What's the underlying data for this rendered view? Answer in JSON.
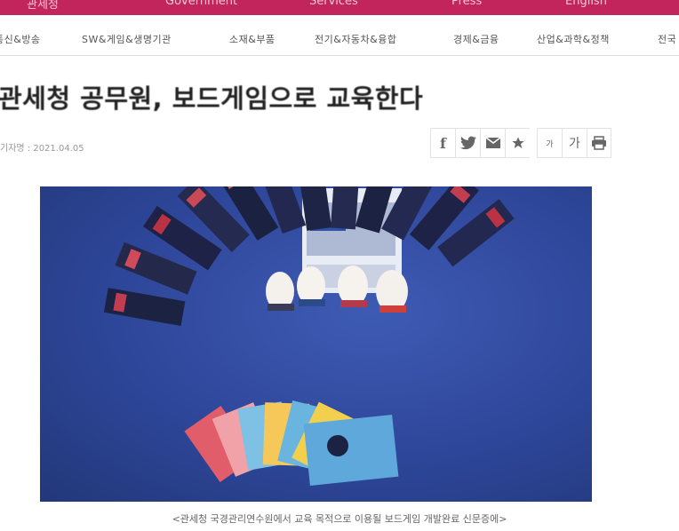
{
  "topbar": {
    "items": [
      "관세청",
      "Government",
      "Services",
      "Press",
      "English"
    ]
  },
  "categories": [
    "통신&방송",
    "SW&게임&생명기관",
    "소재&부품",
    "전기&자동차&융합",
    "경제&금융",
    "산업&과학&정책",
    "전국"
  ],
  "article": {
    "headline": "관세청 공무원, 보드게임으로 교육한다",
    "meta": "기자명 : 2021.04.05",
    "caption": "<관세청 국경관리연수원에서 교육 목적으로 이용될 보드게임 개발완료 신문증에>"
  },
  "tools": {
    "facebook": "f",
    "font_label": "가",
    "font_small": "가"
  },
  "photo_colors": {
    "background": "#2e4699",
    "accent": "#c2255c"
  }
}
